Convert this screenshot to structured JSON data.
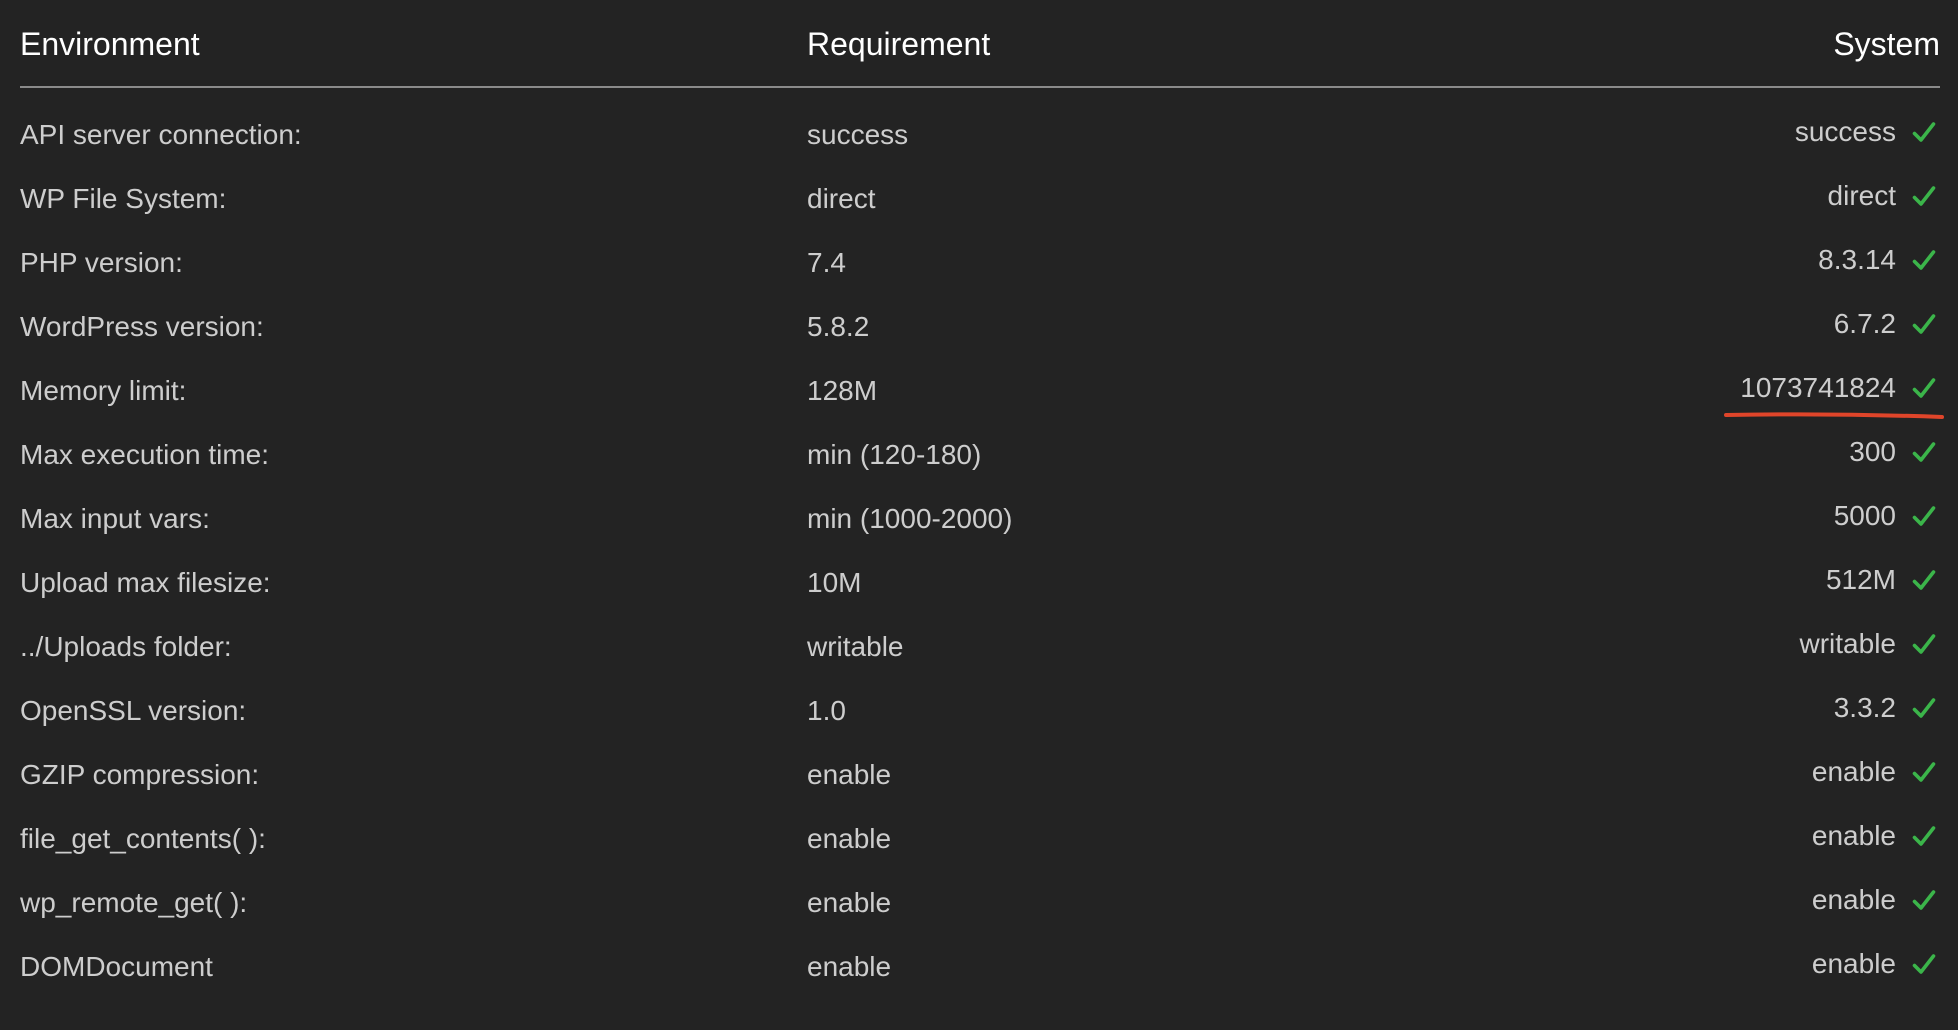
{
  "table": {
    "headers": {
      "environment": "Environment",
      "requirement": "Requirement",
      "system": "System"
    },
    "rows": [
      {
        "environment": "API server connection:",
        "requirement": "success",
        "system": "success",
        "status_icon": "check-icon"
      },
      {
        "environment": "WP File System:",
        "requirement": "direct",
        "system": "direct",
        "status_icon": "check-icon"
      },
      {
        "environment": "PHP version:",
        "requirement": "7.4",
        "system": "8.3.14",
        "status_icon": "check-icon"
      },
      {
        "environment": "WordPress version:",
        "requirement": "5.8.2",
        "system": "6.7.2",
        "status_icon": "check-icon"
      },
      {
        "environment": "Memory limit:",
        "requirement": "128M",
        "system": "1073741824",
        "status_icon": "check-icon",
        "annotated": true
      },
      {
        "environment": "Max execution time:",
        "requirement": "min (120-180)",
        "system": "300",
        "status_icon": "check-icon"
      },
      {
        "environment": "Max input vars:",
        "requirement": "min (1000-2000)",
        "system": "5000",
        "status_icon": "check-icon"
      },
      {
        "environment": "Upload max filesize:",
        "requirement": "10M",
        "system": "512M",
        "status_icon": "check-icon"
      },
      {
        "environment": "../Uploads folder:",
        "requirement": "writable",
        "system": "writable",
        "status_icon": "check-icon"
      },
      {
        "environment": "OpenSSL version:",
        "requirement": "1.0",
        "system": "3.3.2",
        "status_icon": "check-icon"
      },
      {
        "environment": "GZIP compression:",
        "requirement": "enable",
        "system": "enable",
        "status_icon": "check-icon"
      },
      {
        "environment": "file_get_contents( ):",
        "requirement": "enable",
        "system": "enable",
        "status_icon": "check-icon"
      },
      {
        "environment": "wp_remote_get( ):",
        "requirement": "enable",
        "system": "enable",
        "status_icon": "check-icon"
      },
      {
        "environment": "DOMDocument",
        "requirement": "enable",
        "system": "enable",
        "status_icon": "check-icon"
      }
    ]
  },
  "colors": {
    "background": "#232323",
    "header_text": "#ffffff",
    "body_text": "#cdcdcd",
    "divider": "#8a8a8a",
    "check": "#3bb54a",
    "annotation": "#e0452a"
  }
}
